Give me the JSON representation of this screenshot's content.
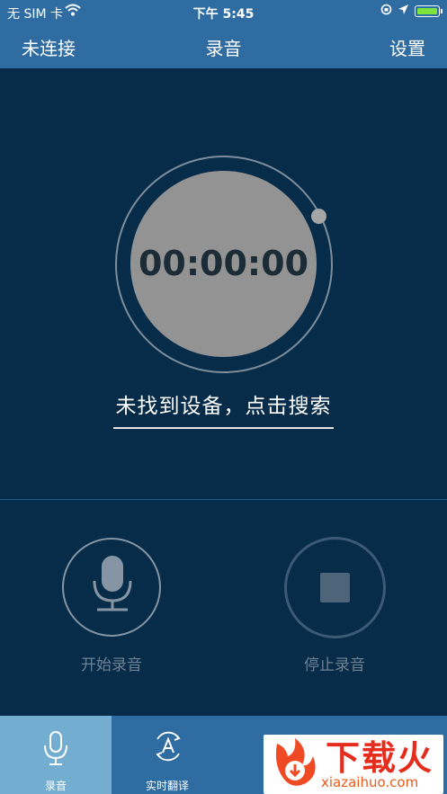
{
  "status_bar": {
    "carrier": "无 SIM 卡",
    "time": "下午 5:45"
  },
  "nav": {
    "left": "未连接",
    "title": "录音",
    "right": "设置"
  },
  "timer": {
    "value": "00:00:00"
  },
  "search_prompt": "未找到设备，点击搜索",
  "controls": {
    "start_label": "开始录音",
    "stop_label": "停止录音"
  },
  "tabs": [
    {
      "label": "录音",
      "icon": "mic-icon",
      "active": true
    },
    {
      "label": "实时翻译",
      "icon": "translate-icon",
      "active": false
    }
  ],
  "watermark": {
    "title": "下载火",
    "url": "xiazaihuo.com"
  },
  "colors": {
    "background": "#062c4a",
    "bar": "#2f6ca2",
    "active_tab": "#73aed1",
    "battery": "#7ee23f"
  }
}
